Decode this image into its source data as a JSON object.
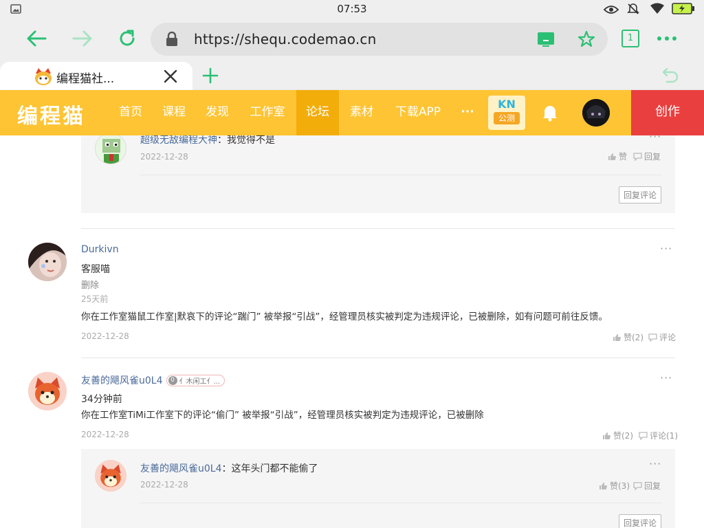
{
  "status_bar": {
    "time": "07:53"
  },
  "browser": {
    "url": "https://shequ.codemao.cn",
    "tab_count": "1",
    "tab_title": "编程猫社...",
    "colors": {
      "accent": "#2bbf74",
      "toolbar_bg": "#efefef"
    }
  },
  "site_nav": {
    "logo": "编程猫",
    "items": [
      "首页",
      "课程",
      "发现",
      "工作室",
      "论坛",
      "素材",
      "下载APP"
    ],
    "active_item": "论坛",
    "more": "···",
    "kn_line1": "KN",
    "kn_line2": "公测",
    "create_label": "创作",
    "colors": {
      "bar": "#fec433",
      "active": "#f2ad0b",
      "create": "#ea3f3f"
    }
  },
  "thread": {
    "top_reply": {
      "author": "超级无敌编程大神",
      "separator": "：",
      "text": "我觉得不是",
      "date": "2022-12-28",
      "like_label": "赞",
      "reply_label": "回复",
      "reply_comment_button": "回复评论"
    },
    "comment1": {
      "author": "Durkivn",
      "line1": "客服喵",
      "line2": "删除",
      "line3": "25天前",
      "line4": "你在工作室猫鼠工作室|默哀下的评论“踹门” 被举报“引战”，经管理员核实被判定为违规评论，已被删除，如有问题可前往反馈。",
      "date": "2022-12-28",
      "like_label": "赞(2)",
      "comment_label": "评论"
    },
    "comment2": {
      "author": "友善的飓风雀u0L4",
      "badge_number": "0",
      "badge_text": "亻木闲工亻...",
      "line1": "34分钟前",
      "line2": "你在工作室TiMi工作室下的评论“偷门” 被举报“引战”，经管理员核实被判定为违规评论，已被删除",
      "date": "2022-12-28",
      "like_label": "赞(2)",
      "comment_label": "评论(1)",
      "reply": {
        "author": "友善的飓风雀u0L4",
        "separator": "：",
        "text": "这年头门都不能偷了",
        "date": "2022-12-28",
        "like_label": "赞(3)",
        "reply_label": "回复",
        "reply_comment_button": "回复评论"
      }
    },
    "more_label": "···"
  }
}
